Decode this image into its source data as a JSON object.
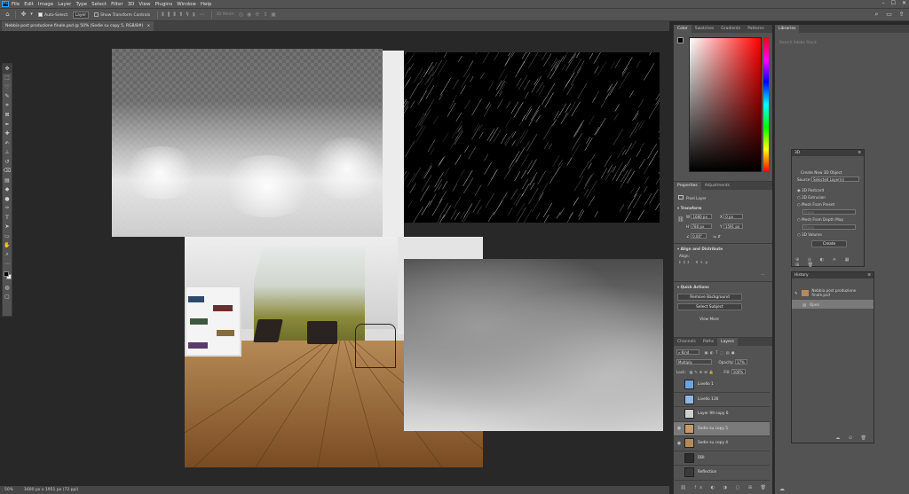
{
  "app": {
    "logo": "Ps"
  },
  "menu": [
    "File",
    "Edit",
    "Image",
    "Layer",
    "Type",
    "Select",
    "Filter",
    "3D",
    "View",
    "Plugins",
    "Window",
    "Help"
  ],
  "options": {
    "auto_select_label": "Auto-Select:",
    "auto_select_value": "Layer",
    "transform_label": "Show Transform Controls",
    "mode_3d": "3D Mode:"
  },
  "document": {
    "tab_title": "Nebbia post produzione finale.psd @ 50% (Sedie su copy 5, RGB/8#)",
    "close": "×"
  },
  "status": {
    "zoom": "50%",
    "info": "1600 px x 1951 px (72 ppi)"
  },
  "color_panel": {
    "tabs": [
      "Color",
      "Swatches",
      "Gradients",
      "Patterns"
    ]
  },
  "properties_panel": {
    "tabs": [
      "Properties",
      "Adjustments"
    ],
    "kind": "Pixel Layer",
    "transform_title": "Transform",
    "w_label": "W",
    "w_value": "1680 px",
    "h_label": "H",
    "h_value": "780 px",
    "x_label": "X",
    "x_value": "0 px",
    "y_label": "Y",
    "y_value": "1591 px",
    "angle_value": "0.00°",
    "align_title": "Align and Distribute",
    "align_label": "Align:",
    "quick_title": "Quick Actions",
    "remove_bg": "Remove Background",
    "select_subject": "Select Subject",
    "view_more": "View More"
  },
  "layers_panel": {
    "tabs": [
      "Channels",
      "Paths",
      "Layers"
    ],
    "kind_label": "Kind",
    "blend_mode": "Multiply",
    "opacity_label": "Opacity:",
    "opacity_value": "17%",
    "lock_label": "Lock:",
    "fill_label": "Fill:",
    "fill_value": "100%",
    "layers": [
      {
        "name": "Livello 1",
        "visible": false,
        "selected": false,
        "thumb": "#6aa4e0"
      },
      {
        "name": "Livello 136",
        "visible": false,
        "selected": false,
        "thumb": "#8fb8e6"
      },
      {
        "name": "Layer 99 copy 6",
        "visible": false,
        "selected": false,
        "thumb": "#cfcfcf"
      },
      {
        "name": "Sedie su copy 5",
        "visible": true,
        "selected": true,
        "thumb": "#c59a6a"
      },
      {
        "name": "Sedie su copy 4",
        "visible": true,
        "selected": false,
        "thumb": "#b58a5a"
      },
      {
        "name": "DBI",
        "visible": false,
        "selected": false,
        "thumb": "#2c2c2c"
      },
      {
        "name": "Reflection",
        "visible": false,
        "selected": false,
        "thumb": "#3a3a3a"
      }
    ]
  },
  "libraries_panel": {
    "tab": "Libraries",
    "search_placeholder": "Search Adobe Stock"
  },
  "panel_3d": {
    "title": "3D",
    "create_label": "Create New 3D Object",
    "source_label": "Source:",
    "source_value": "Selected Layer(s)",
    "options": [
      "3D Postcard",
      "3D Extrusion",
      "Mesh From Preset",
      "Mesh From Depth Map",
      "3D Volume"
    ],
    "preset_placeholder": "Plane",
    "depth_placeholder": "Plane",
    "create_button": "Create"
  },
  "history_panel": {
    "title": "History",
    "items": [
      "Nebbia post produzione finale.psd",
      "Open"
    ]
  },
  "colors": {
    "accent": "#31a8ff",
    "panel": "#535353",
    "canvas": "#282828"
  }
}
